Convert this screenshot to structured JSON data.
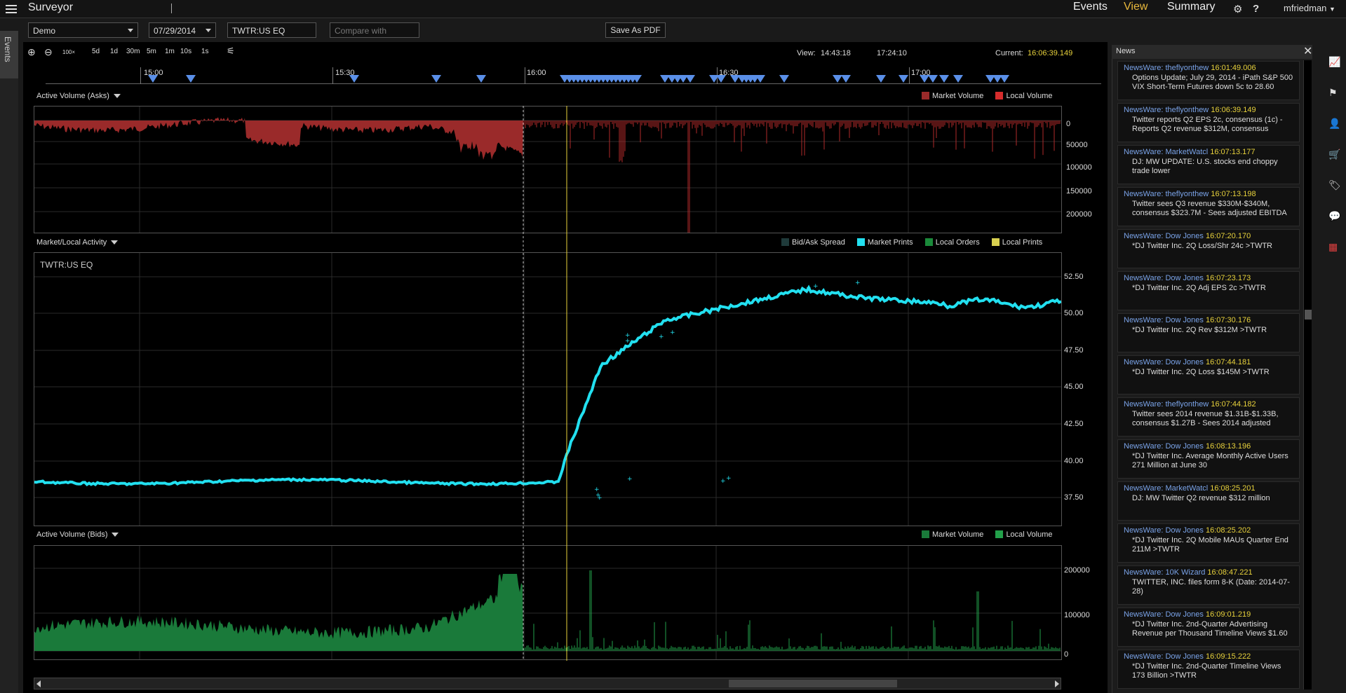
{
  "app": {
    "title": "Surveyor",
    "user": "mfriedman"
  },
  "nav": {
    "events": "Events",
    "view": "View",
    "summary": "Summary"
  },
  "icons": {
    "menu": "hamburger-icon",
    "settings": "gear-icon",
    "help": "question-icon",
    "user_caret": "chevron-down-icon"
  },
  "side_tab": {
    "label": "Events"
  },
  "toolbar": {
    "account": "Demo",
    "date": "07/29/2014",
    "symbol": "TWTR:US EQ",
    "compare_placeholder": "Compare with",
    "save_pdf": "Save As PDF"
  },
  "zoom": {
    "buttons": [
      "100×",
      "5d",
      "1d",
      "30m",
      "5m",
      "1m",
      "10s",
      "1s"
    ],
    "view_label": "View:",
    "view_start": "14:43:18",
    "view_end": "17:24:10",
    "current_label": "Current:",
    "current_value": "16:06:39.149"
  },
  "timeline": {
    "ticks": [
      "15:00",
      "15:30",
      "16:00",
      "16:30",
      "17:00"
    ]
  },
  "panels": {
    "asks": {
      "title": "Active Volume (Asks)",
      "legend": [
        "Market Volume",
        "Local Volume"
      ],
      "yticks": [
        "0",
        "50000",
        "100000",
        "150000",
        "200000"
      ],
      "colors": [
        "#9a2a2a",
        "#d62c2c"
      ]
    },
    "activity": {
      "title": "Market/Local Activity",
      "symbol_label": "TWTR:US EQ",
      "legend": [
        "Bid/Ask Spread",
        "Market Prints",
        "Local Orders",
        "Local Prints"
      ],
      "colors": [
        "#1f3a3a",
        "#22e0f0",
        "#1a8a3a",
        "#d8d050"
      ],
      "yticks": [
        "52.50",
        "50.00",
        "47.50",
        "45.00",
        "42.50",
        "40.00",
        "37.50"
      ]
    },
    "bids": {
      "title": "Active Volume (Bids)",
      "legend": [
        "Market Volume",
        "Local Volume"
      ],
      "yticks": [
        "200000",
        "100000",
        "0"
      ],
      "colors": [
        "#1a7a3a",
        "#22a04a"
      ]
    }
  },
  "news": {
    "title": "News",
    "items": [
      {
        "source": "NewsWare: theflyonthew",
        "time": "16:01:49.006",
        "text": "Options Update; July 29, 2014 - iPath S&P 500 VIX Short-Term Futures down 5c to 28.60"
      },
      {
        "source": "NewsWare: theflyonthew",
        "time": "16:06:39.149",
        "text": "Twitter reports Q2 EPS 2c, consensus (1c) - Reports Q2 revenue $312M, consensus"
      },
      {
        "source": "NewsWare: MarketWatcl",
        "time": "16:07:13.177",
        "text": "DJ: MW UPDATE: U.S. stocks end choppy trade lower"
      },
      {
        "source": "NewsWare: theflyonthew",
        "time": "16:07:13.198",
        "text": "Twitter sees Q3 revenue $330M-$340M, consensus $323.7M - Sees adjusted EBITDA"
      },
      {
        "source": "NewsWare: Dow Jones",
        "time": "16:07:20.170",
        "text": "*DJ Twitter Inc. 2Q Loss/Shr 24c >TWTR"
      },
      {
        "source": "NewsWare: Dow Jones",
        "time": "16:07:23.173",
        "text": "*DJ Twitter Inc. 2Q Adj EPS 2c >TWTR"
      },
      {
        "source": "NewsWare: Dow Jones",
        "time": "16:07:30.176",
        "text": "*DJ Twitter Inc. 2Q Rev $312M >TWTR"
      },
      {
        "source": "NewsWare: Dow Jones",
        "time": "16:07:44.181",
        "text": "*DJ Twitter Inc. 2Q Loss $145M >TWTR"
      },
      {
        "source": "NewsWare: theflyonthew",
        "time": "16:07:44.182",
        "text": "Twitter sees 2014 revenue $1.31B-$1.33B, consensus $1.27B - Sees 2014 adjusted"
      },
      {
        "source": "NewsWare: Dow Jones",
        "time": "16:08:13.196",
        "text": "*DJ Twitter Inc. Average Monthly Active Users 271 Million at June 30"
      },
      {
        "source": "NewsWare: MarketWatcl",
        "time": "16:08:25.201",
        "text": "DJ: MW Twitter Q2 revenue $312 million"
      },
      {
        "source": "NewsWare: Dow Jones",
        "time": "16:08:25.202",
        "text": "*DJ Twitter Inc. 2Q Mobile MAUs Quarter End 211M >TWTR"
      },
      {
        "source": "NewsWare: 10K Wizard",
        "time": "16:08:47.221",
        "text": "TWITTER, INC. files form 8-K (Date: 2014-07-28)"
      },
      {
        "source": "NewsWare: Dow Jones",
        "time": "16:09:01.219",
        "text": "*DJ Twitter Inc. 2nd-Quarter Advertising Revenue per Thousand Timeline Views $1.60"
      },
      {
        "source": "NewsWare: Dow Jones",
        "time": "16:09:15.222",
        "text": "*DJ Twitter Inc. 2nd-Quarter Timeline Views 173 Billion >TWTR"
      }
    ]
  },
  "right_icons": [
    "chart-icon",
    "flag-icon",
    "user-check-icon",
    "cart-icon",
    "tag-icon",
    "chat-icon",
    "grid-icon"
  ]
}
